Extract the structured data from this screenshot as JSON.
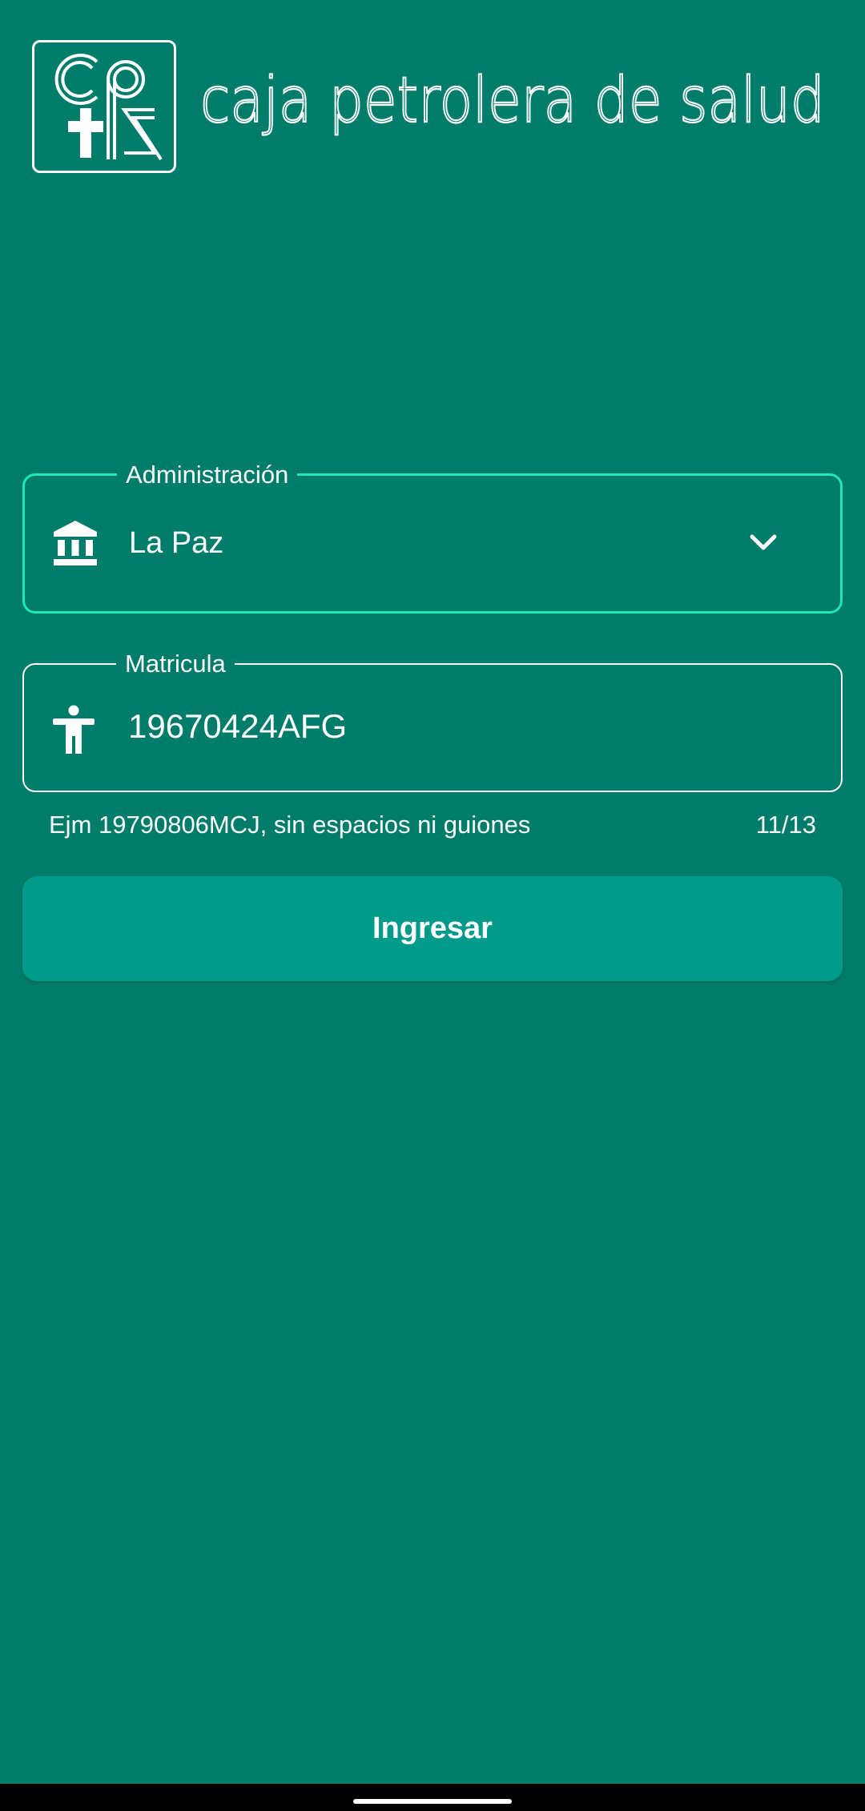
{
  "header": {
    "logo_letters": "cpS",
    "brand_name": "caja petrolera de salud"
  },
  "login_form": {
    "administracion": {
      "label": "Administración",
      "value": "La Paz",
      "icon": "bank-icon"
    },
    "matricula": {
      "label": "Matricula",
      "value": "19670424AFG",
      "icon": "accessibility-person-icon",
      "helper_text": "Ejm 19790806MCJ, sin espacios ni guiones",
      "counter": "11/13"
    },
    "submit_label": "Ingresar"
  },
  "colors": {
    "background": "#007d6a",
    "button": "#009b8b",
    "focus_outline": "#1de9b6"
  }
}
